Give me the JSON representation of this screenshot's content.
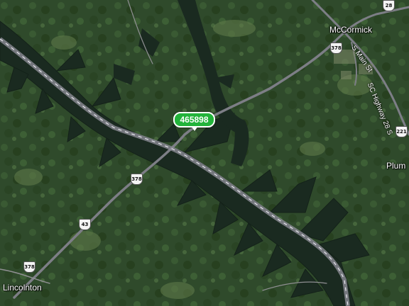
{
  "map": {
    "view": "aerial",
    "colors": {
      "forest": "#2f4a2b",
      "water": "#1a2a20",
      "road": "#8a8a90",
      "pin": "#22b33a"
    },
    "marker": {
      "label": "465898"
    },
    "places": {
      "mccormick": "McCormick",
      "plum": "Plum",
      "lincolnton": "Lincolnton"
    },
    "shields": {
      "us378_north": "378",
      "us378_mid": "378",
      "us378_south": "378",
      "ga43": "43",
      "sc28": "221",
      "top_right": "28"
    },
    "road_labels": {
      "main_st": "S Main St",
      "sc_highway": "SC Highway 28 S"
    }
  }
}
